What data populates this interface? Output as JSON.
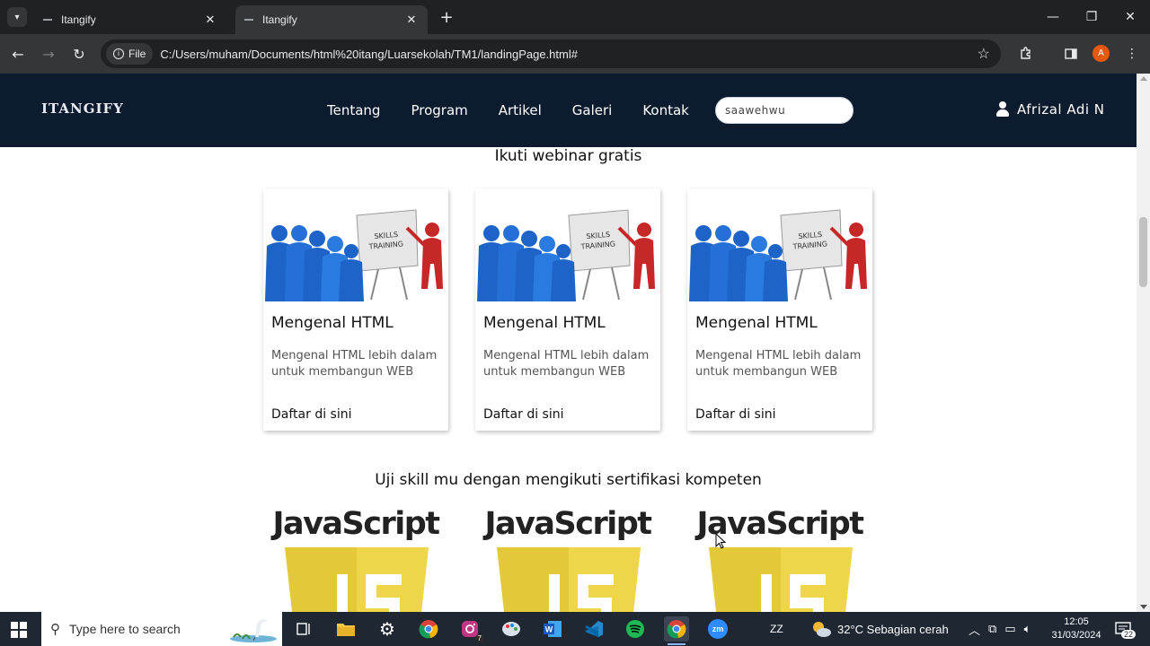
{
  "browser": {
    "tabs": [
      {
        "title": "Itangify",
        "active": false
      },
      {
        "title": "Itangify",
        "active": true
      }
    ],
    "file_chip": "File",
    "url": "C:/Users/muham/Documents/html%20itang/Luarsekolah/TM1/landingPage.html#",
    "profile_initial": "A"
  },
  "site": {
    "logo": "ITANGIFY",
    "menu": [
      "Tentang",
      "Program",
      "Artikel",
      "Galeri",
      "Kontak"
    ],
    "search_value": "saawehwu",
    "user_name": "Afrizal Adi N",
    "colors": {
      "nav_bg": "#0d1b2e",
      "js_yellow": "#e3c93a"
    }
  },
  "webinar": {
    "heading": "Ikuti webinar gratis",
    "image_text": "SKILLS TRAINING",
    "cards": [
      {
        "title": "Mengenal HTML",
        "desc": "Mengenal HTML lebih dalam untuk membangun WEB",
        "link": "Daftar di sini"
      },
      {
        "title": "Mengenal HTML",
        "desc": "Mengenal HTML lebih dalam untuk membangun WEB",
        "link": "Daftar di sini"
      },
      {
        "title": "Mengenal HTML",
        "desc": "Mengenal HTML lebih dalam untuk membangun WEB",
        "link": "Daftar di sini"
      }
    ]
  },
  "certification": {
    "heading": "Uji skill mu dengan mengikuti sertifikasi kompeten",
    "cards": [
      {
        "label": "JavaScript"
      },
      {
        "label": "JavaScript"
      },
      {
        "label": "JavaScript"
      }
    ]
  },
  "taskbar": {
    "search_placeholder": "Type here to search",
    "instagram_badge": "7",
    "zoom_label": "zm",
    "zz_label": "ZZ",
    "weather": "32°C  Sebagian cerah",
    "time": "12:05",
    "date": "31/03/2024",
    "notification_count": "22"
  }
}
